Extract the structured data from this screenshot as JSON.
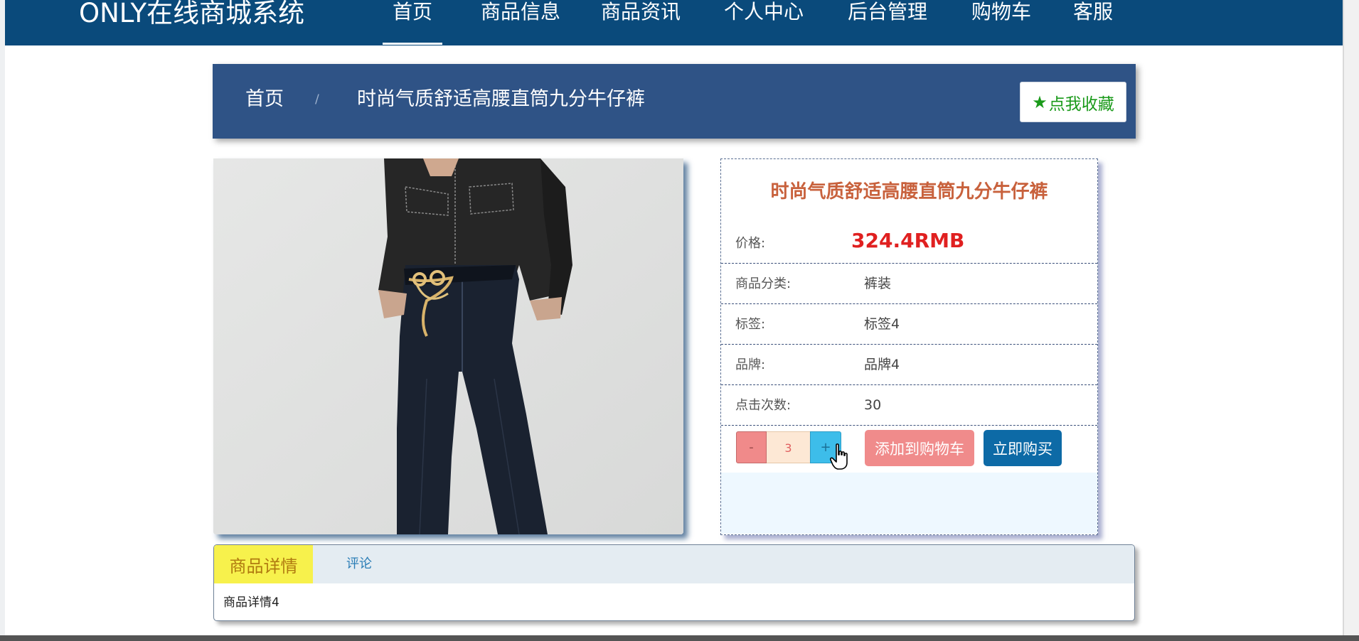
{
  "nav": {
    "brand": "ONLY在线商城系统",
    "items": [
      {
        "label": "首页",
        "active": true
      },
      {
        "label": "商品信息",
        "active": false
      },
      {
        "label": "商品资讯",
        "active": false
      },
      {
        "label": "个人中心",
        "active": false
      },
      {
        "label": "后台管理",
        "active": false
      },
      {
        "label": "购物车",
        "active": false
      },
      {
        "label": "客服",
        "active": false
      }
    ]
  },
  "breadcrumb": {
    "home": "首页",
    "separator": "/",
    "current": "时尚气质舒适高腰直筒九分牛仔裤"
  },
  "favorite": {
    "icon": "star-icon",
    "label": "点我收藏"
  },
  "product": {
    "title": "时尚气质舒适高腰直筒九分牛仔裤",
    "price_label": "价格:",
    "price": "324.4RMB",
    "category_label": "商品分类:",
    "category": "裤装",
    "tag_label": "标签:",
    "tag": "标签4",
    "brand_label": "品牌:",
    "brand": "品牌4",
    "clicks_label": "点击次数:",
    "clicks": "30"
  },
  "purchase": {
    "minus": "-",
    "quantity": "3",
    "plus": "+",
    "add_to_cart": "添加到购物车",
    "buy_now": "立即购买"
  },
  "tabs": {
    "detail": "商品详情",
    "comments": "评论",
    "content": "商品详情4"
  },
  "colors": {
    "nav_bg": "#0a4a7b",
    "crumb_bg": "#2f5386",
    "title_color": "#c8613c",
    "price_color": "#e02020",
    "add_cart_bg": "#f08b8b",
    "buy_now_bg": "#0d6aa6"
  }
}
